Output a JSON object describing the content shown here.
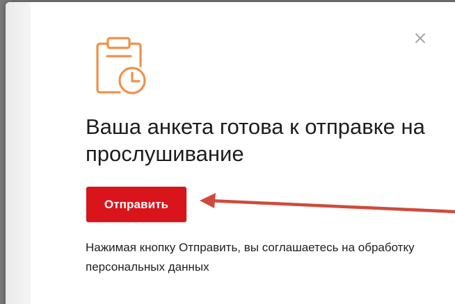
{
  "modal": {
    "title": "Ваша анкета готова к отправке на прослушивание",
    "send_button_label": "Отправить",
    "consent_text": "Нажимая кнопку Отправить, вы соглашаетесь на обработку персональных данных",
    "close_icon": "close-icon",
    "illustration_icon": "clipboard-clock-icon"
  },
  "colors": {
    "accent": "#d9141b",
    "icon": "#f0914a",
    "annotation_arrow": "#d04a3c",
    "text": "#1d1d1d"
  }
}
